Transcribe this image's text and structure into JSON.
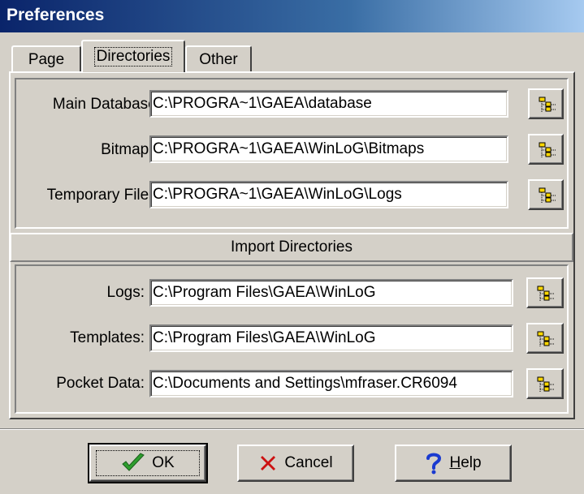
{
  "window": {
    "title": "Preferences"
  },
  "tabs": [
    {
      "label": "Page"
    },
    {
      "label": "Directories"
    },
    {
      "label": "Other"
    }
  ],
  "directories": [
    {
      "label": "Main Database:",
      "value": "C:\\PROGRA~1\\GAEA\\database"
    },
    {
      "label": "Bitmaps:",
      "value": "C:\\PROGRA~1\\GAEA\\WinLoG\\Bitmaps"
    },
    {
      "label": "Temporary Files:",
      "value": "C:\\PROGRA~1\\GAEA\\WinLoG\\Logs"
    }
  ],
  "import_section": {
    "title": "Import Directories",
    "items": [
      {
        "label": "Logs:",
        "value": "C:\\Program Files\\GAEA\\WinLoG"
      },
      {
        "label": "Templates:",
        "value": "C:\\Program Files\\GAEA\\WinLoG"
      },
      {
        "label": "Pocket Data:",
        "value": "C:\\Documents and Settings\\mfraser.CR6094"
      }
    ]
  },
  "buttons": {
    "ok": "OK",
    "cancel": "Cancel",
    "help_hotkey": "H",
    "help_rest": "elp"
  },
  "icons": {
    "browse": "folder-tree-icon",
    "ok": "checkmark-icon",
    "cancel": "x-icon",
    "help": "question-mark-icon"
  },
  "colors": {
    "titlebar_start": "#0a246a",
    "titlebar_end": "#a6caf0",
    "face": "#d4d0c8",
    "ok_check": "#2e9e2e",
    "cancel_x": "#cc1111",
    "help_q": "#1a3ad0"
  }
}
